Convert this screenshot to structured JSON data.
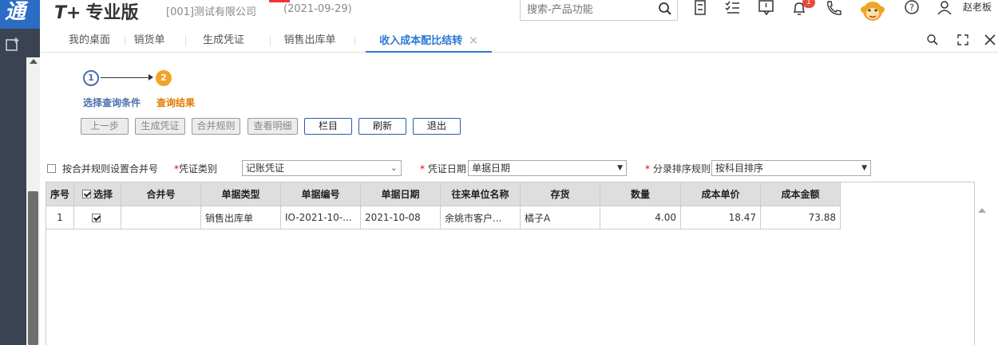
{
  "header": {
    "logo_text": "通",
    "brand_prefix": "T+",
    "brand_name": "专业版",
    "company": "[001]测试有限公司",
    "date": "(2021-09-29)",
    "search_placeholder": "搜索-产品功能",
    "notification_count": "1",
    "user_name": "赵老板"
  },
  "tabs": [
    {
      "label": "我的桌面",
      "active": false
    },
    {
      "label": "销货单",
      "active": false
    },
    {
      "label": "生成凭证",
      "active": false
    },
    {
      "label": "销售出库单",
      "active": false
    },
    {
      "label": "收入成本配比结转",
      "active": true
    }
  ],
  "steps": [
    {
      "number": "1",
      "label": "选择查询条件"
    },
    {
      "number": "2",
      "label": "查询结果"
    }
  ],
  "buttons": {
    "prev": "上一步",
    "generate": "生成凭证",
    "merge": "合并规则",
    "detail": "查看明细",
    "columns": "栏目",
    "refresh": "刷新",
    "exit": "退出"
  },
  "filters": {
    "merge_rule_label": "按合并规则设置合并号",
    "voucher_type_label": "凭证类别",
    "voucher_type_value": "记账凭证",
    "voucher_date_label": "凭证日期",
    "voucher_date_value": "单据日期",
    "sort_rule_label": "分录排序规则",
    "sort_rule_value": "按科目排序"
  },
  "table": {
    "columns": [
      "序号",
      "选择",
      "合并号",
      "单据类型",
      "单据编号",
      "单据日期",
      "往来单位名称",
      "存货",
      "数量",
      "成本单价",
      "成本金额"
    ],
    "rows": [
      {
        "index": "1",
        "selected": true,
        "merge_no": "",
        "doc_type": "销售出库单",
        "doc_no": "IO-2021-10-...",
        "doc_date": "2021-10-08",
        "partner": "余姚市客户...",
        "stock": "橘子A",
        "qty": "4.00",
        "unit_cost": "18.47",
        "cost_amount": "73.88"
      }
    ]
  },
  "colors": {
    "accent": "#2b78d4",
    "step_done": "#4a6ea9",
    "step_current": "#f0a529",
    "sidebar": "#3b4252"
  }
}
